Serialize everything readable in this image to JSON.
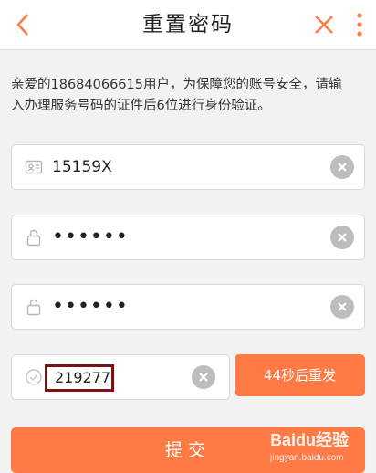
{
  "header": {
    "title": "重置密码",
    "back_icon": "chevron-left-icon",
    "close_icon": "close-icon",
    "more_icon": "more-vertical-icon",
    "accent_color": "#ff7a45"
  },
  "notice": {
    "line1": "亲爱的18684066615用户，为保障您的账号安全，请输",
    "line2": "入办理服务号码的证件后6位进行身份验证。"
  },
  "form": {
    "id_field": {
      "value": "15159X",
      "icon": "id-card-icon"
    },
    "new_password": {
      "value": "••••••",
      "icon": "lock-icon"
    },
    "confirm_password": {
      "value": "••••••",
      "icon": "lock-icon"
    },
    "sms_code": {
      "value": "219277",
      "icon": "check-circle-icon"
    },
    "resend_label": "44秒后重发",
    "submit_label": "提交"
  },
  "watermark": {
    "brand": "Baidu经验",
    "url": "jingyan.baidu.com"
  }
}
